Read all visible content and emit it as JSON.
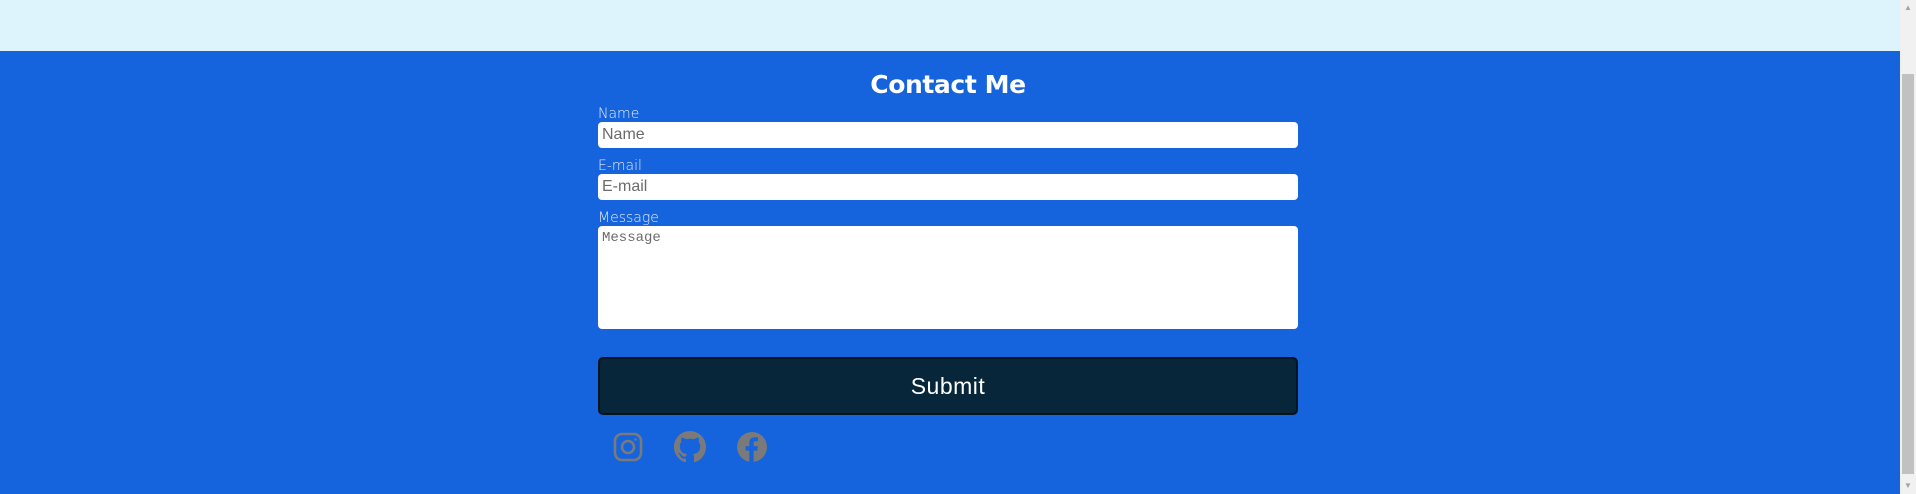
{
  "contact": {
    "title": "Contact Me",
    "name_label": "Name",
    "name_placeholder": "Name",
    "email_label": "E-mail",
    "email_placeholder": "E-mail",
    "message_label": "Message",
    "message_placeholder": "Message",
    "submit_label": "Submit"
  },
  "socials": [
    {
      "icon": "instagram-icon"
    },
    {
      "icon": "github-icon"
    },
    {
      "icon": "facebook-icon"
    }
  ],
  "colors": {
    "top_band": "#ddf4fd",
    "section_bg": "#1563dd",
    "button_bg": "#07263a",
    "icon": "#7a7a7a"
  }
}
